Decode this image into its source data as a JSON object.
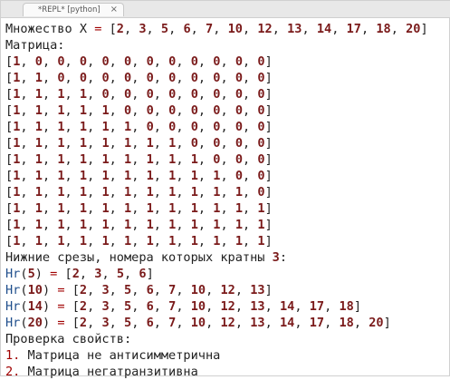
{
  "tab": {
    "title": "*REPL* [python]",
    "close_glyph": "×"
  },
  "header": {
    "set_label": "Множество X",
    "set_values": [
      "2",
      "3",
      "5",
      "6",
      "7",
      "10",
      "12",
      "13",
      "14",
      "17",
      "18",
      "20"
    ],
    "matrix_label": "Матрица:"
  },
  "matrix": [
    [
      "1",
      "0",
      "0",
      "0",
      "0",
      "0",
      "0",
      "0",
      "0",
      "0",
      "0",
      "0"
    ],
    [
      "1",
      "1",
      "0",
      "0",
      "0",
      "0",
      "0",
      "0",
      "0",
      "0",
      "0",
      "0"
    ],
    [
      "1",
      "1",
      "1",
      "1",
      "0",
      "0",
      "0",
      "0",
      "0",
      "0",
      "0",
      "0"
    ],
    [
      "1",
      "1",
      "1",
      "1",
      "1",
      "0",
      "0",
      "0",
      "0",
      "0",
      "0",
      "0"
    ],
    [
      "1",
      "1",
      "1",
      "1",
      "1",
      "1",
      "0",
      "0",
      "0",
      "0",
      "0",
      "0"
    ],
    [
      "1",
      "1",
      "1",
      "1",
      "1",
      "1",
      "1",
      "1",
      "0",
      "0",
      "0",
      "0"
    ],
    [
      "1",
      "1",
      "1",
      "1",
      "1",
      "1",
      "1",
      "1",
      "1",
      "0",
      "0",
      "0"
    ],
    [
      "1",
      "1",
      "1",
      "1",
      "1",
      "1",
      "1",
      "1",
      "1",
      "1",
      "0",
      "0"
    ],
    [
      "1",
      "1",
      "1",
      "1",
      "1",
      "1",
      "1",
      "1",
      "1",
      "1",
      "1",
      "0"
    ],
    [
      "1",
      "1",
      "1",
      "1",
      "1",
      "1",
      "1",
      "1",
      "1",
      "1",
      "1",
      "1"
    ],
    [
      "1",
      "1",
      "1",
      "1",
      "1",
      "1",
      "1",
      "1",
      "1",
      "1",
      "1",
      "1"
    ],
    [
      "1",
      "1",
      "1",
      "1",
      "1",
      "1",
      "1",
      "1",
      "1",
      "1",
      "1",
      "1"
    ]
  ],
  "slices": {
    "heading_text": "Нижние срезы, номера которых кратны ",
    "heading_num": "3",
    "heading_suffix": ":",
    "items": [
      {
        "func": "Hr",
        "arg": "5",
        "values": [
          "2",
          "3",
          "5",
          "6"
        ]
      },
      {
        "func": "Hr",
        "arg": "10",
        "values": [
          "2",
          "3",
          "5",
          "6",
          "7",
          "10",
          "12",
          "13"
        ]
      },
      {
        "func": "Hr",
        "arg": "14",
        "values": [
          "2",
          "3",
          "5",
          "6",
          "7",
          "10",
          "12",
          "13",
          "14",
          "17",
          "18"
        ]
      },
      {
        "func": "Hr",
        "arg": "20",
        "values": [
          "2",
          "3",
          "5",
          "6",
          "7",
          "10",
          "12",
          "13",
          "14",
          "17",
          "18",
          "20"
        ]
      }
    ]
  },
  "properties": {
    "heading": "Проверка свойств:",
    "items": [
      {
        "num": "1.",
        "text": " Матрица не антисимметрична"
      },
      {
        "num": "2.",
        "text": " Матрица негатранзитивна"
      }
    ]
  },
  "colors": {
    "number": "#7a1a1a",
    "function": "#1f4e8c",
    "operator": "#a00000",
    "text": "#222222"
  }
}
